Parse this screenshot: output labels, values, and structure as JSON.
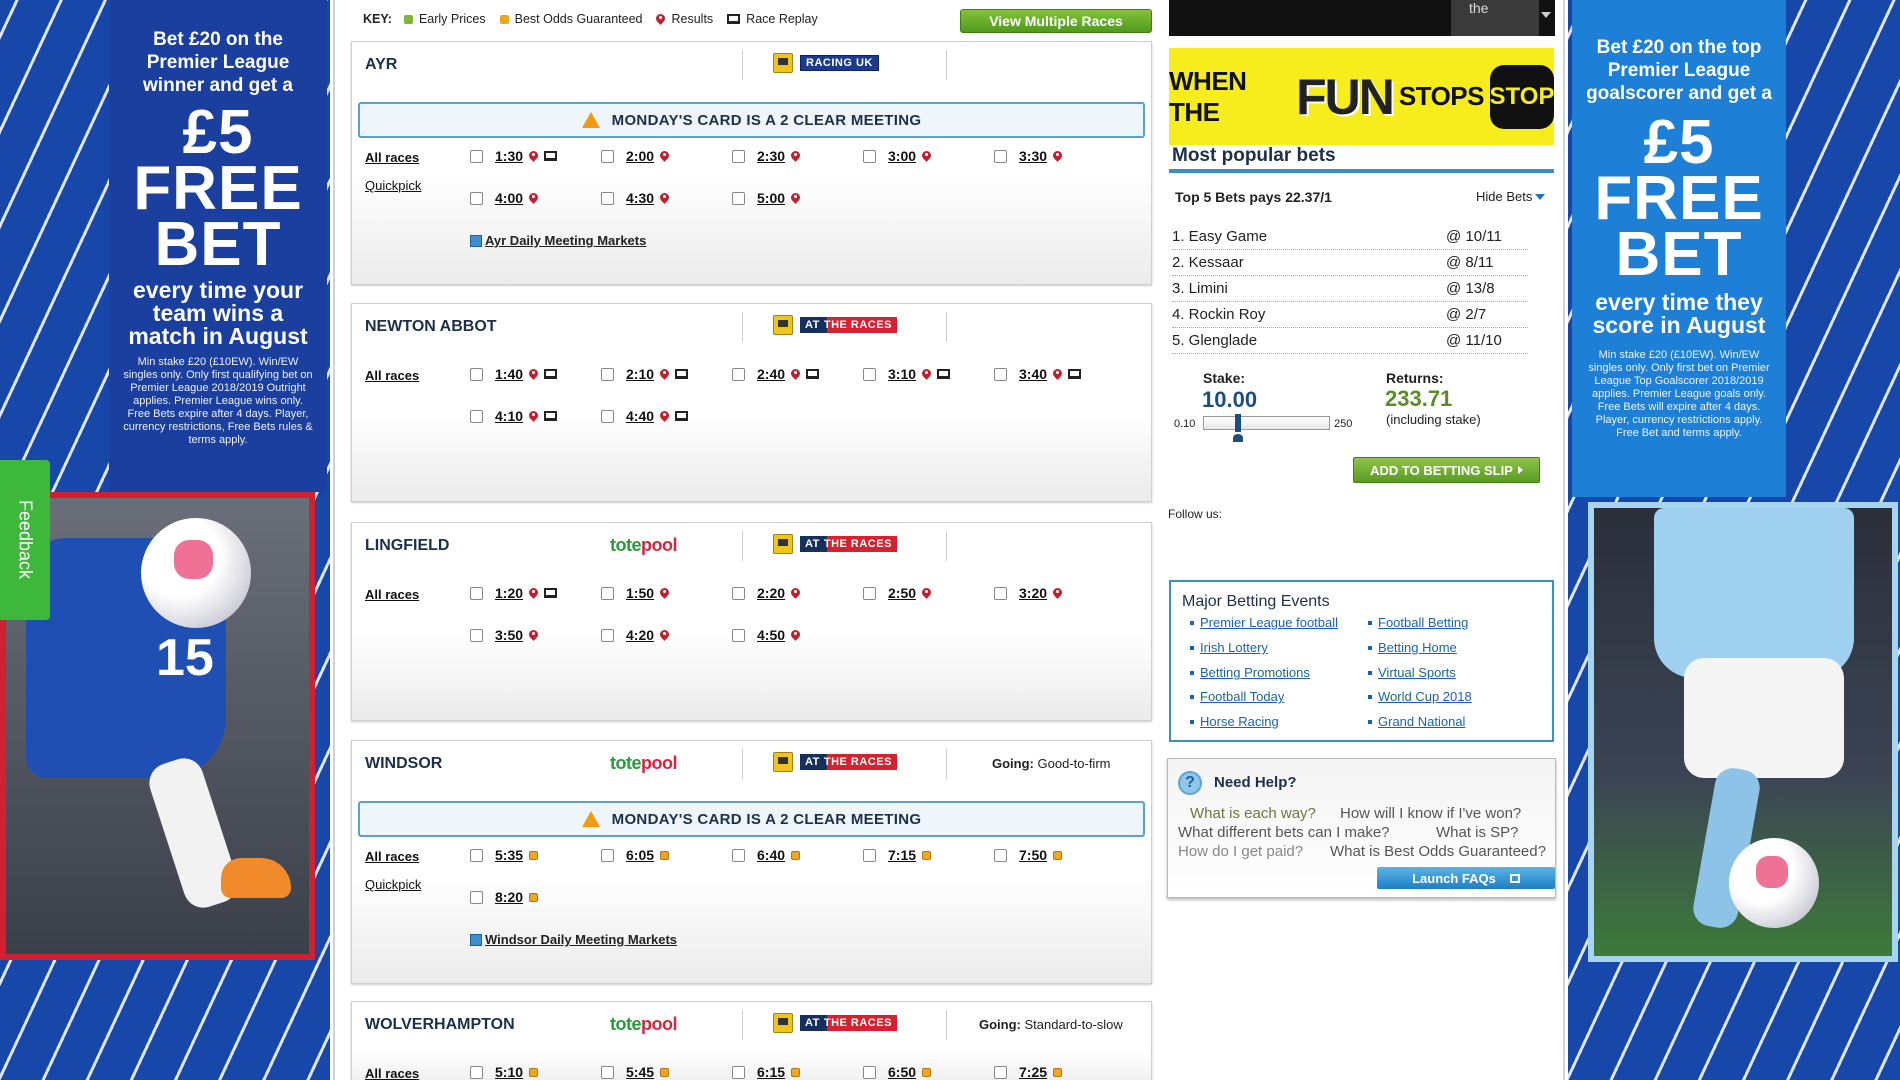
{
  "left_ad": {
    "line1": "Bet £20 on the",
    "line2": "Premier League",
    "line3": "winner and get a",
    "big1": "£5",
    "big2": "FREE",
    "big3": "BET",
    "mid1": "every time your",
    "mid2": "team wins a",
    "mid3": "match in August",
    "fine": "Min stake £20 (£10EW). Win/EW singles only. Only first qualifying bet on Premier League 2018/2019 Outright applies. Premier League wins only. Free Bets expire after 4 days. Player, currency restrictions, Free Bets rules & terms apply.",
    "shirt": "15"
  },
  "right_ad": {
    "line1": "Bet £20 on the top",
    "line2": "Premier League",
    "line3": "goalscorer and get a",
    "big1": "£5",
    "big2": "FREE",
    "big3": "BET",
    "mid1": "every time they",
    "mid2": "score in August",
    "fine": "Min stake £20 (£10EW). Win/EW singles only. Only first bet on Premier League Top Goalscorer 2018/2019 applies. Premier League goals only. Free Bets will expire after 4 days. Player, currency restrictions apply. Free Bet and terms apply."
  },
  "feedback": "Feedback",
  "key": {
    "label": "KEY:",
    "early": "Early Prices",
    "bog": "Best Odds Guaranteed",
    "results": "Results",
    "replay": "Race Replay"
  },
  "view_multiple": "View Multiple Races",
  "labels": {
    "all_races": "All races",
    "quickpick": "Quickpick",
    "going": "Going:",
    "warning": "MONDAY'S CARD IS A 2 CLEAR MEETING",
    "tote1": "tote",
    "tote2": "pool",
    "ruk": "RACING UK",
    "atr1": "AT",
    "atr2": "THE RACES"
  },
  "meetings": [
    {
      "name": "AYR",
      "tv": "RACING UK",
      "going": "",
      "races": [
        "1:30",
        "2:00",
        "2:30",
        "3:00",
        "3:30",
        "4:00",
        "4:30",
        "5:00"
      ],
      "markets": "Ayr Daily Meeting Markets"
    },
    {
      "name": "NEWTON ABBOT",
      "tv": "AT THE RACES",
      "going": "",
      "races": [
        "1:40",
        "2:10",
        "2:40",
        "3:10",
        "3:40",
        "4:10",
        "4:40"
      ]
    },
    {
      "name": "LINGFIELD",
      "tv": "AT THE RACES",
      "going": "",
      "races": [
        "1:20",
        "1:50",
        "2:20",
        "2:50",
        "3:20",
        "3:50",
        "4:20",
        "4:50"
      ]
    },
    {
      "name": "WINDSOR",
      "tv": "AT THE RACES",
      "going": "Good-to-firm",
      "races": [
        "5:35",
        "6:05",
        "6:40",
        "7:15",
        "7:50",
        "8:20"
      ],
      "markets": "Windsor Daily Meeting Markets"
    },
    {
      "name": "WOLVERHAMPTON",
      "tv": "AT THE RACES",
      "going": "Standard-to-slow",
      "races": [
        "5:10",
        "5:45",
        "6:15",
        "6:50",
        "7:25"
      ]
    }
  ],
  "video": {
    "thumb": "the"
  },
  "funstop": {
    "t1": "WHEN THE",
    "t2": "FUN",
    "t3": "STOPS",
    "t4": "STOP"
  },
  "popular": {
    "title": "Most popular bets",
    "top5": "Top 5 Bets pays 22.37/1",
    "hide": "Hide Bets",
    "bets": [
      {
        "sel": "1. Easy Game",
        "odds": "@ 10/11"
      },
      {
        "sel": "2. Kessaar",
        "odds": "@ 8/11"
      },
      {
        "sel": "3. Limini",
        "odds": "@ 13/8"
      },
      {
        "sel": "4. Rockin Roy",
        "odds": "@ 2/7"
      },
      {
        "sel": "5. Glenglade",
        "odds": "@ 11/10"
      }
    ],
    "stake_label": "Stake:",
    "stake": "10.00",
    "returns_label": "Returns:",
    "returns": "233.71",
    "incl": "(including stake)",
    "min": "0.10",
    "max": "250",
    "stake_level": 0.04,
    "add": "ADD TO BETTING SLIP"
  },
  "follow": "Follow us:",
  "major": {
    "title": "Major Betting Events",
    "links": [
      "Premier League football",
      "Football Betting",
      "Irish Lottery",
      "Betting Home",
      "Betting Promotions",
      "Virtual Sports",
      "Football Today",
      "World Cup 2018",
      "Horse Racing",
      "Grand National"
    ]
  },
  "help": {
    "title": "Need Help?",
    "faqs": [
      "What is each way?",
      "How will I know if I've won?",
      "What different bets can I make?",
      "What is SP?",
      "How do I get paid?",
      "What is Best Odds Guaranteed?"
    ],
    "launch": "Launch FAQs"
  }
}
